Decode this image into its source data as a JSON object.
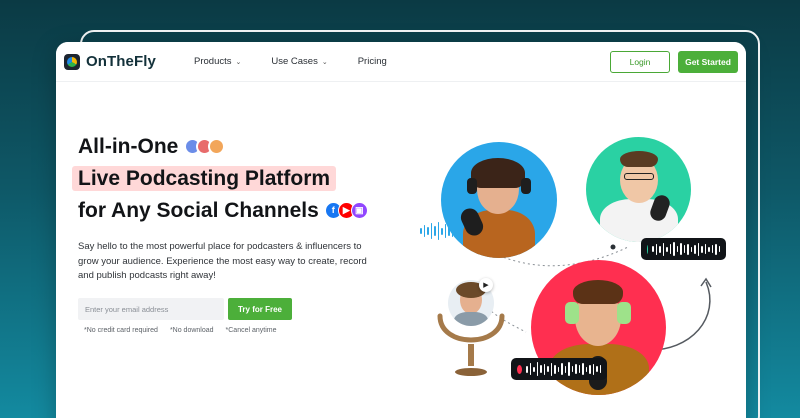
{
  "brand": {
    "name": "OnTheFly"
  },
  "nav": {
    "items": [
      {
        "label": "Products",
        "dropdown": true
      },
      {
        "label": "Use Cases",
        "dropdown": true
      },
      {
        "label": "Pricing",
        "dropdown": false
      }
    ],
    "login_label": "Login",
    "get_started_label": "Get Started"
  },
  "hero": {
    "line1": "All-in-One",
    "line2": "Live Podcasting Platform",
    "line3": "for Any Social Channels",
    "description": "Say hello to the most powerful place for podcasters & influencers to grow your audience. Experience the most easy way to create, record and publish podcasts right away!",
    "email_placeholder": "Enter your email address",
    "cta_label": "Try for Free",
    "notes": [
      "*No credit card required",
      "*No download",
      "*Cancel anytime"
    ]
  },
  "colors": {
    "accent": "#4caf3a",
    "highlight": "#ffd8d8",
    "circle_blue": "#2aa6e8",
    "circle_teal": "#2ad1a3",
    "circle_red": "#ff2f50"
  },
  "icons": [
    "logo-icon",
    "chevron-down-icon",
    "facebook-icon",
    "youtube-icon",
    "twitch-icon",
    "play-icon",
    "microphone-icon",
    "curved-arrow-icon"
  ]
}
